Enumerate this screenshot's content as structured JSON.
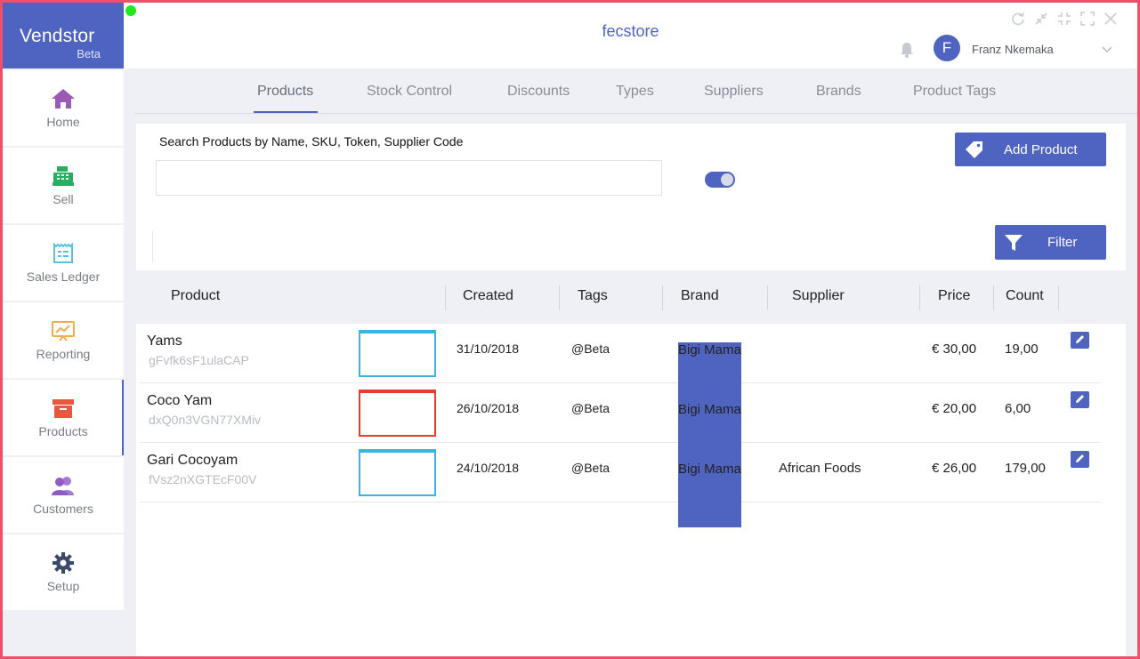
{
  "brand": {
    "name": "Vendstor",
    "sub": "Beta"
  },
  "sidebar": {
    "items": [
      {
        "label": "Home",
        "icon": "home-icon",
        "color": "#9b59b6"
      },
      {
        "label": "Sell",
        "icon": "cash-register-icon",
        "color": "#27ae60"
      },
      {
        "label": "Sales Ledger",
        "icon": "ledger-icon",
        "color": "#5bc0de"
      },
      {
        "label": "Reporting",
        "icon": "chart-board-icon",
        "color": "#f0ad4e"
      },
      {
        "label": "Products",
        "icon": "box-icon",
        "color": "#e9573f",
        "active": true
      },
      {
        "label": "Customers",
        "icon": "users-icon",
        "color": "#8e5cc2"
      },
      {
        "label": "Setup",
        "icon": "gear-icon",
        "color": "#3a4a6b"
      }
    ]
  },
  "header": {
    "store_name": "fecstore",
    "avatar_letter": "F",
    "user_name": "Franz Nkemaka"
  },
  "tabs": [
    {
      "label": "Products",
      "active": true
    },
    {
      "label": "Stock Control"
    },
    {
      "label": "Discounts"
    },
    {
      "label": "Types"
    },
    {
      "label": "Suppliers"
    },
    {
      "label": "Brands"
    },
    {
      "label": "Product Tags"
    }
  ],
  "search": {
    "label": "Search Products by Name, SKU, Token, Supplier Code",
    "value": "",
    "placeholder": ""
  },
  "buttons": {
    "add_product": "Add Product",
    "filter": "Filter"
  },
  "table": {
    "columns": [
      "Product",
      "Created",
      "Tags",
      "Brand",
      "Supplier",
      "Price",
      "Count"
    ],
    "rows": [
      {
        "name": "Yams",
        "sku": "gFvfk6sF1ulaCAP",
        "thumb_color": "#38b6df",
        "created": "31/10/2018",
        "tags": "@Beta",
        "brand": "Bigi Mama",
        "supplier": "",
        "price": "€ 30,00",
        "count": "19,00"
      },
      {
        "name": "Coco Yam",
        "sku": "dxQ0n3VGN77XMiv",
        "thumb_color": "#e53c32",
        "created": "26/10/2018",
        "tags": "@Beta",
        "brand": "Bigi Mama",
        "supplier": "",
        "price": "€ 20,00",
        "count": "6,00"
      },
      {
        "name": "Gari Cocoyam",
        "sku": "fVsz2nXGTEcF00V",
        "thumb_color": "#38b6df",
        "created": "24/10/2018",
        "tags": "@Beta",
        "brand": "Bigi Mama",
        "supplier": "African Foods",
        "price": "€ 26,00",
        "count": "179,00"
      }
    ]
  },
  "colors": {
    "accent": "#4f63c0",
    "frame": "#ef4f6b",
    "status_dot": "#1ee81e"
  }
}
